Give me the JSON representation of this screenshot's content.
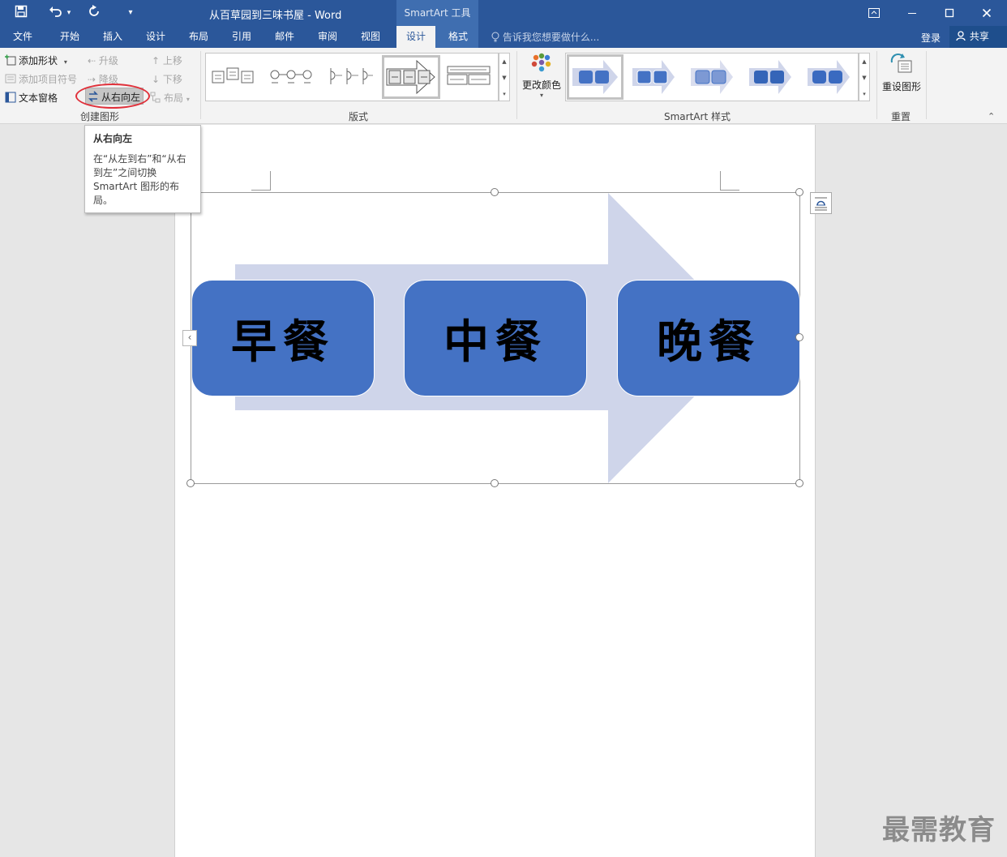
{
  "titlebar": {
    "doc_title": "从百草园到三味书屋 - Word",
    "context_tool": "SmartArt 工具"
  },
  "tabs": {
    "file": "文件",
    "home": "开始",
    "insert": "插入",
    "design": "设计",
    "layout": "布局",
    "references": "引用",
    "mailings": "邮件",
    "review": "审阅",
    "view": "视图",
    "smartart_design": "设计",
    "smartart_format": "格式",
    "tell_me": "告诉我您想要做什么...",
    "login": "登录",
    "share": "共享"
  },
  "ribbon": {
    "create_graphic": {
      "add_shape": "添加形状",
      "add_bullet": "添加项目符号",
      "text_pane": "文本窗格",
      "promote": "升级",
      "demote": "降级",
      "right_to_left": "从右向左",
      "move_up": "上移",
      "move_down": "下移",
      "layout": "布局",
      "label": "创建图形"
    },
    "layouts_label": "版式",
    "change_colors": "更改颜色",
    "styles_label": "SmartArt 样式",
    "reset_graphic": "重设图形",
    "reset_label": "重置"
  },
  "tooltip": {
    "title": "从右向左",
    "description": "在“从左到右”和“从右到左”之间切换 SmartArt 图形的布局。"
  },
  "smartart": {
    "nodes": [
      "早餐",
      "中餐",
      "晚餐"
    ],
    "node_color": "#4472c4",
    "arrow_color": "#cfd5ea"
  },
  "watermark": "最需教育",
  "colors": {
    "title_bar": "#2b579a",
    "context_tab": "#3f6eb0",
    "highlight_ring": "#e0303a"
  }
}
